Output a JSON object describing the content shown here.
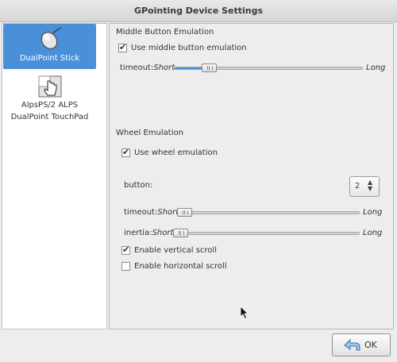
{
  "window": {
    "title": "GPointing Device Settings"
  },
  "devices": [
    {
      "label": "DualPoint Stick",
      "icon": "mouse-icon",
      "selected": true
    },
    {
      "label": "AlpsPS/2 ALPS DualPoint TouchPad",
      "icon": "touchpad-hand-icon",
      "selected": false
    }
  ],
  "middle_button": {
    "section_title": "Middle Button Emulation",
    "checkbox_label": "Use middle button emulation",
    "checked": true,
    "timeout_label": "timeout:",
    "timeout_min": "Short",
    "timeout_max": "Long",
    "timeout_level": 0.12
  },
  "wheel": {
    "section_title": "Wheel Emulation",
    "checkbox_label": "Use wheel emulation",
    "checked": true,
    "button_label": "button:",
    "button_value": "2",
    "timeout_label": "timeout:",
    "timeout_min": "Short",
    "timeout_max": "Long",
    "timeout_level": 0.0,
    "inertia_label": "inertia:",
    "inertia_min": "Short",
    "inertia_max": "Long",
    "inertia_level": 0.0,
    "vertical_scroll_label": "Enable vertical scroll",
    "vertical_scroll_checked": true,
    "horizontal_scroll_label": "Enable horizontal scroll",
    "horizontal_scroll_checked": false
  },
  "buttons": {
    "ok_label": "OK"
  },
  "colors": {
    "accent": "#4a90d9",
    "background": "#ededed"
  }
}
